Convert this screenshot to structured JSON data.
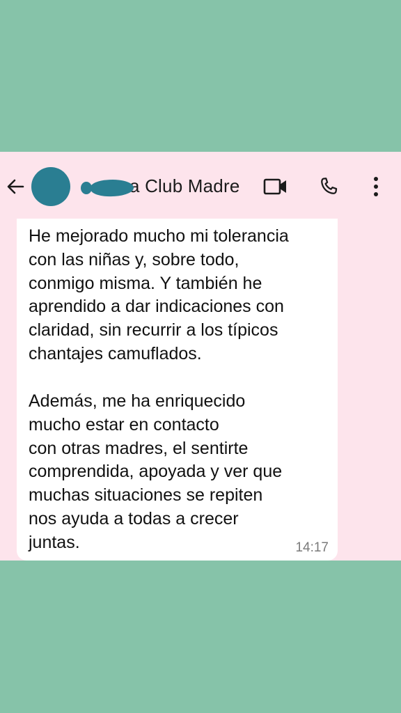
{
  "colors": {
    "outer_background": "#86c3a9",
    "chat_background": "#fde4ec",
    "bubble": "#ffffff",
    "redaction": "#2a7e92"
  },
  "header": {
    "back_icon": "arrow-left-icon",
    "visible_title": "a Club Madre",
    "video_icon": "video-camera-icon",
    "call_icon": "phone-icon",
    "more_icon": "more-vertical-icon"
  },
  "message": {
    "paragraph_1": [
      "He mejorado mucho mi tolerancia",
      "con las niñas y, sobre todo,",
      "conmigo misma. Y también he",
      "aprendido a dar indicaciones con",
      "claridad, sin recurrir a los típicos",
      "chantajes camuflados."
    ],
    "paragraph_2": [
      "Además, me ha enriquecido",
      "mucho estar en contacto",
      "con otras madres, el sentirte",
      "comprendida, apoyada y ver que",
      "muchas situaciones se repiten",
      "nos ayuda a todas a crecer",
      "juntas."
    ],
    "time": "14:17"
  }
}
